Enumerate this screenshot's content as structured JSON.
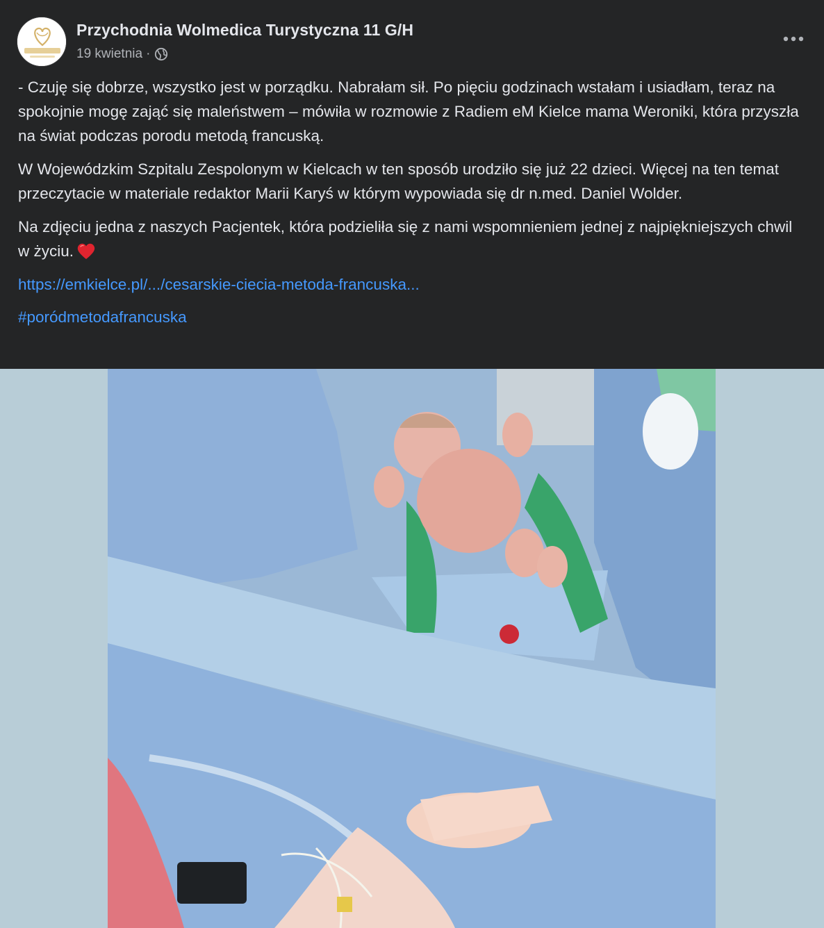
{
  "post": {
    "page_name": "Przychodnia Wolmedica Turystyczna 11 G/H",
    "date": "19 kwietnia",
    "separator": "·",
    "privacy_icon": "globe-icon",
    "more_icon": "more-horizontal-icon",
    "avatar_logo_text": "WOLMEDICA",
    "paragraphs": [
      "- Czuję się dobrze, wszystko jest w porządku. Nabrałam sił. Po pięciu godzinach wstałam i usiadłam, teraz na spokojnie mogę zająć się maleństwem – mówiła w rozmowie z Radiem eM Kielce mama Weroniki, która przyszła na świat podczas porodu metodą francuską.",
      "W Wojewódzkim Szpitalu Zespolonym w Kielcach w ten sposób urodziło się już 22 dzieci. Więcej na ten temat przeczytacie w materiale redaktor Marii Karyś w którym wypowiada się dr n.med. Daniel Wolder.",
      "Na zdjęciu jedna z naszych Pacjentek, która podzieliła się z nami wspomnieniem jednej z najpiękniejszych chwil w życiu."
    ],
    "heart_icon": "red-heart-emoji",
    "link": "https://emkielce.pl/.../cesarskie-ciecia-metoda-francuska...",
    "hashtag": "#poródmetodafrancuska"
  },
  "colors": {
    "background": "#242526",
    "text": "#e4e6eb",
    "secondary_text": "#b0b3b8",
    "link": "#4599ff",
    "photo_backdrop": "#b8cdd7"
  }
}
